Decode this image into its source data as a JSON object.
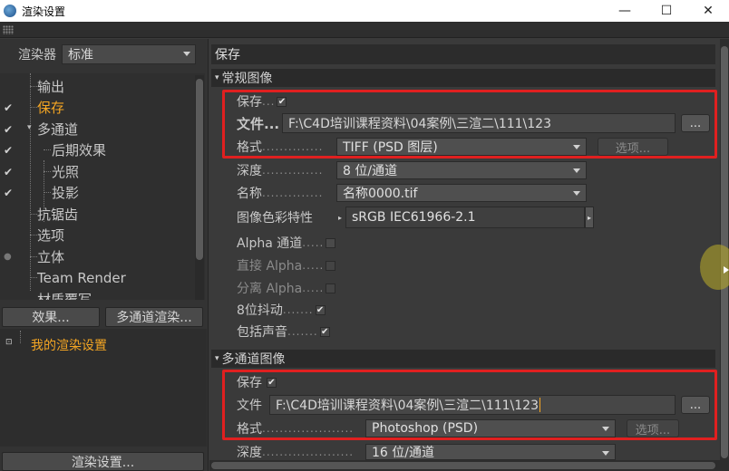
{
  "window": {
    "title": "渲染设置",
    "min_glyph": "—",
    "max_glyph": "☐",
    "close_glyph": "✕"
  },
  "left": {
    "renderer_label": "渲染器",
    "renderer_value": "标准",
    "tree": [
      {
        "label": "输出",
        "checked": "",
        "active": false
      },
      {
        "label": "保存",
        "checked": "✔",
        "active": true
      },
      {
        "label": "多通道",
        "checked": "✔",
        "active": false
      },
      {
        "label": "后期效果",
        "checked": "✔",
        "active": false
      },
      {
        "label": "光照",
        "checked": "✔",
        "active": false
      },
      {
        "label": "投影",
        "checked": "✔",
        "active": false
      },
      {
        "label": "抗锯齿",
        "checked": "",
        "active": false
      },
      {
        "label": "选项",
        "checked": "",
        "active": false
      },
      {
        "label": "立体",
        "checked": "●",
        "active": false
      },
      {
        "label": "Team Render",
        "checked": "",
        "active": false
      },
      {
        "label": "材质覆写",
        "checked": "",
        "active": false
      }
    ],
    "effects_button": "效果...",
    "multipass_button": "多通道渲染...",
    "my_render_setting": "我的渲染设置",
    "render_settings_button": "渲染设置..."
  },
  "right": {
    "tab_title": "保存",
    "regular_section": "常规图像",
    "regular": {
      "save_label": "保存",
      "save_dots": "...",
      "save_checked": "✔",
      "file_label": "文件...",
      "file_path": "F:\\C4D培训课程资料\\04案例\\三渲二\\111\\123",
      "browse_label": "...",
      "format_label": "格式",
      "format_dots": "..............",
      "format_value": "TIFF (PSD 图层)",
      "options_button": "选项...",
      "depth_label": "深度",
      "depth_dots": "..............",
      "depth_value": "8 位/通道",
      "name_label": "名称",
      "name_dots": "..............",
      "name_value": "名称0000.tif",
      "colorprofile_label": "图像色彩特性",
      "colorprofile_value": "sRGB IEC61966-2.1",
      "alpha_label": "Alpha 通道",
      "alpha_dots": ".....",
      "straight_alpha_label": "直接 Alpha",
      "straight_alpha_dots": ".....",
      "separate_alpha_label": "分离 Alpha",
      "separate_alpha_dots": ".....",
      "dither_label": "8位抖动",
      "dither_dots": ".......",
      "dither_checked": "✔",
      "sound_label": "包括声音",
      "sound_dots": ".......",
      "sound_checked": "✔"
    },
    "multipass_section": "多通道图像",
    "multipass": {
      "save_label": "保存",
      "save_checked": "✔",
      "file_label": "文件",
      "file_path": "F:\\C4D培训课程资料\\04案例\\三渲二\\111\\123",
      "browse_label": "...",
      "format_label": "格式",
      "format_dots": ".....................",
      "format_value": "Photoshop (PSD)",
      "options_button": "选项...",
      "depth_label": "深度",
      "depth_dots": ".....................",
      "depth_value": "16 位/通道"
    }
  },
  "colors": {
    "accent_active": "#f5a623",
    "highlight_box": "#e02020",
    "panel_bg": "#3a3a3a"
  }
}
